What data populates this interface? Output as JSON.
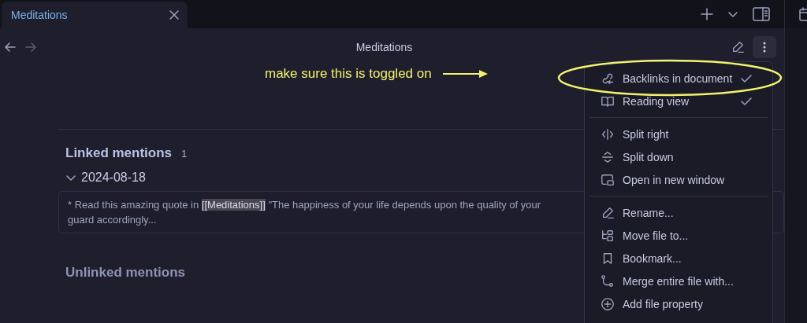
{
  "tab": {
    "label": "Meditations",
    "selected": true
  },
  "header": {
    "title": "Meditations"
  },
  "backlinks": {
    "linked_title": "Linked mentions",
    "linked_count": "1",
    "groups": [
      {
        "title": "2024-08-18",
        "expanded": true,
        "snippet_prefix": "* Read this amazing quote in ",
        "snippet_link": "[[Meditations]]",
        "snippet_rest": " \"The happiness of your life depends upon the quality of your",
        "snippet_line2": "guard accordingly..."
      }
    ],
    "unlinked_title": "Unlinked mentions"
  },
  "menu": [
    {
      "kind": "item",
      "label": "Backlinks in document",
      "checked": true
    },
    {
      "kind": "item",
      "label": "Reading view",
      "checked": true
    },
    {
      "kind": "divider"
    },
    {
      "kind": "item",
      "label": "Split right",
      "checked": false
    },
    {
      "kind": "item",
      "label": "Split down",
      "checked": false
    },
    {
      "kind": "item",
      "label": "Open in new window",
      "checked": false
    },
    {
      "kind": "divider"
    },
    {
      "kind": "item",
      "label": "Rename...",
      "checked": false
    },
    {
      "kind": "item",
      "label": "Move file to...",
      "checked": false
    },
    {
      "kind": "item",
      "label": "Bookmark...",
      "checked": false
    },
    {
      "kind": "item",
      "label": "Merge entire file with...",
      "checked": false
    },
    {
      "kind": "item",
      "label": "Add file property",
      "checked": false
    }
  ],
  "annotation": {
    "text": "make sure this is toggled on"
  }
}
